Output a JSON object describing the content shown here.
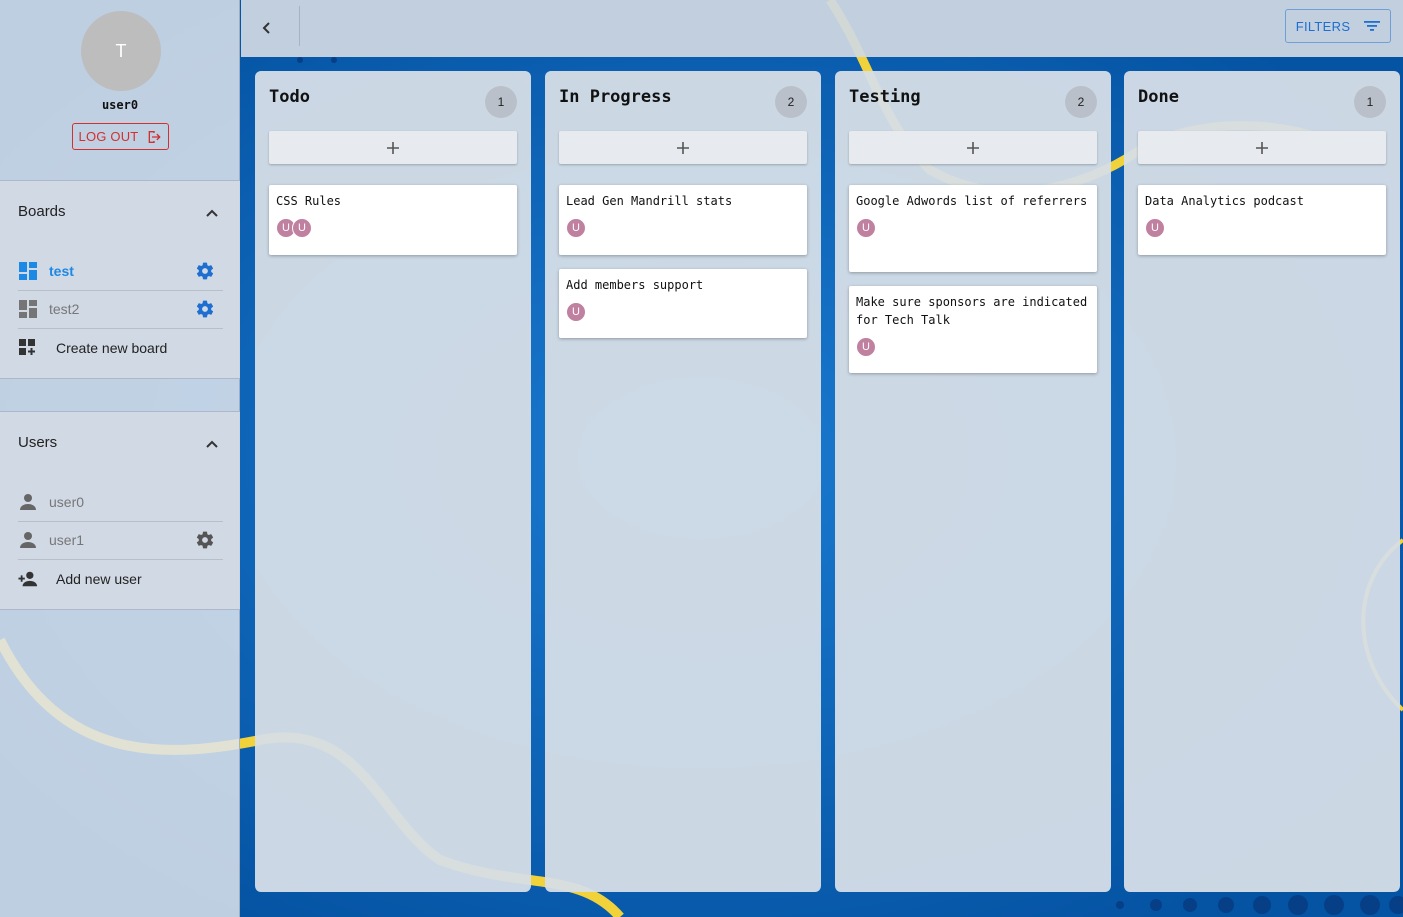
{
  "profile": {
    "avatar_initial": "T",
    "username": "user0",
    "logout_label": "LOG OUT"
  },
  "boards_panel": {
    "title": "Boards",
    "items": [
      {
        "label": "test",
        "active": true
      },
      {
        "label": "test2",
        "active": false
      }
    ],
    "create_label": "Create new board"
  },
  "users_panel": {
    "title": "Users",
    "items": [
      {
        "label": "user0"
      },
      {
        "label": "user1"
      }
    ],
    "add_label": "Add new user"
  },
  "toolbar": {
    "filters_label": "FILTERS"
  },
  "columns": [
    {
      "title": "Todo",
      "count": "1",
      "add_label": "+",
      "cards": [
        {
          "text": "CSS Rules",
          "avatars": [
            "U",
            "U"
          ]
        }
      ]
    },
    {
      "title": "In Progress",
      "count": "2",
      "add_label": "+",
      "cards": [
        {
          "text": "Lead Gen Mandrill stats",
          "avatars": [
            "U"
          ]
        },
        {
          "text": "Add members support",
          "avatars": [
            "U"
          ]
        }
      ]
    },
    {
      "title": "Testing",
      "count": "2",
      "add_label": "+",
      "cards": [
        {
          "text": "Google Adwords list of referrers",
          "avatars": [
            "U"
          ]
        },
        {
          "text": "Make sure sponsors are indicated for Tech Talk",
          "avatars": [
            "U"
          ]
        }
      ]
    },
    {
      "title": "Done",
      "count": "1",
      "add_label": "+",
      "cards": [
        {
          "text": "Data Analytics podcast",
          "avatars": [
            "U"
          ]
        }
      ]
    }
  ],
  "colors": {
    "accent": "#1e88e5",
    "danger": "#d32f2f",
    "avatar": "#c0809f",
    "background": "#0a5fb0",
    "decor_line": "#f2d23a"
  }
}
